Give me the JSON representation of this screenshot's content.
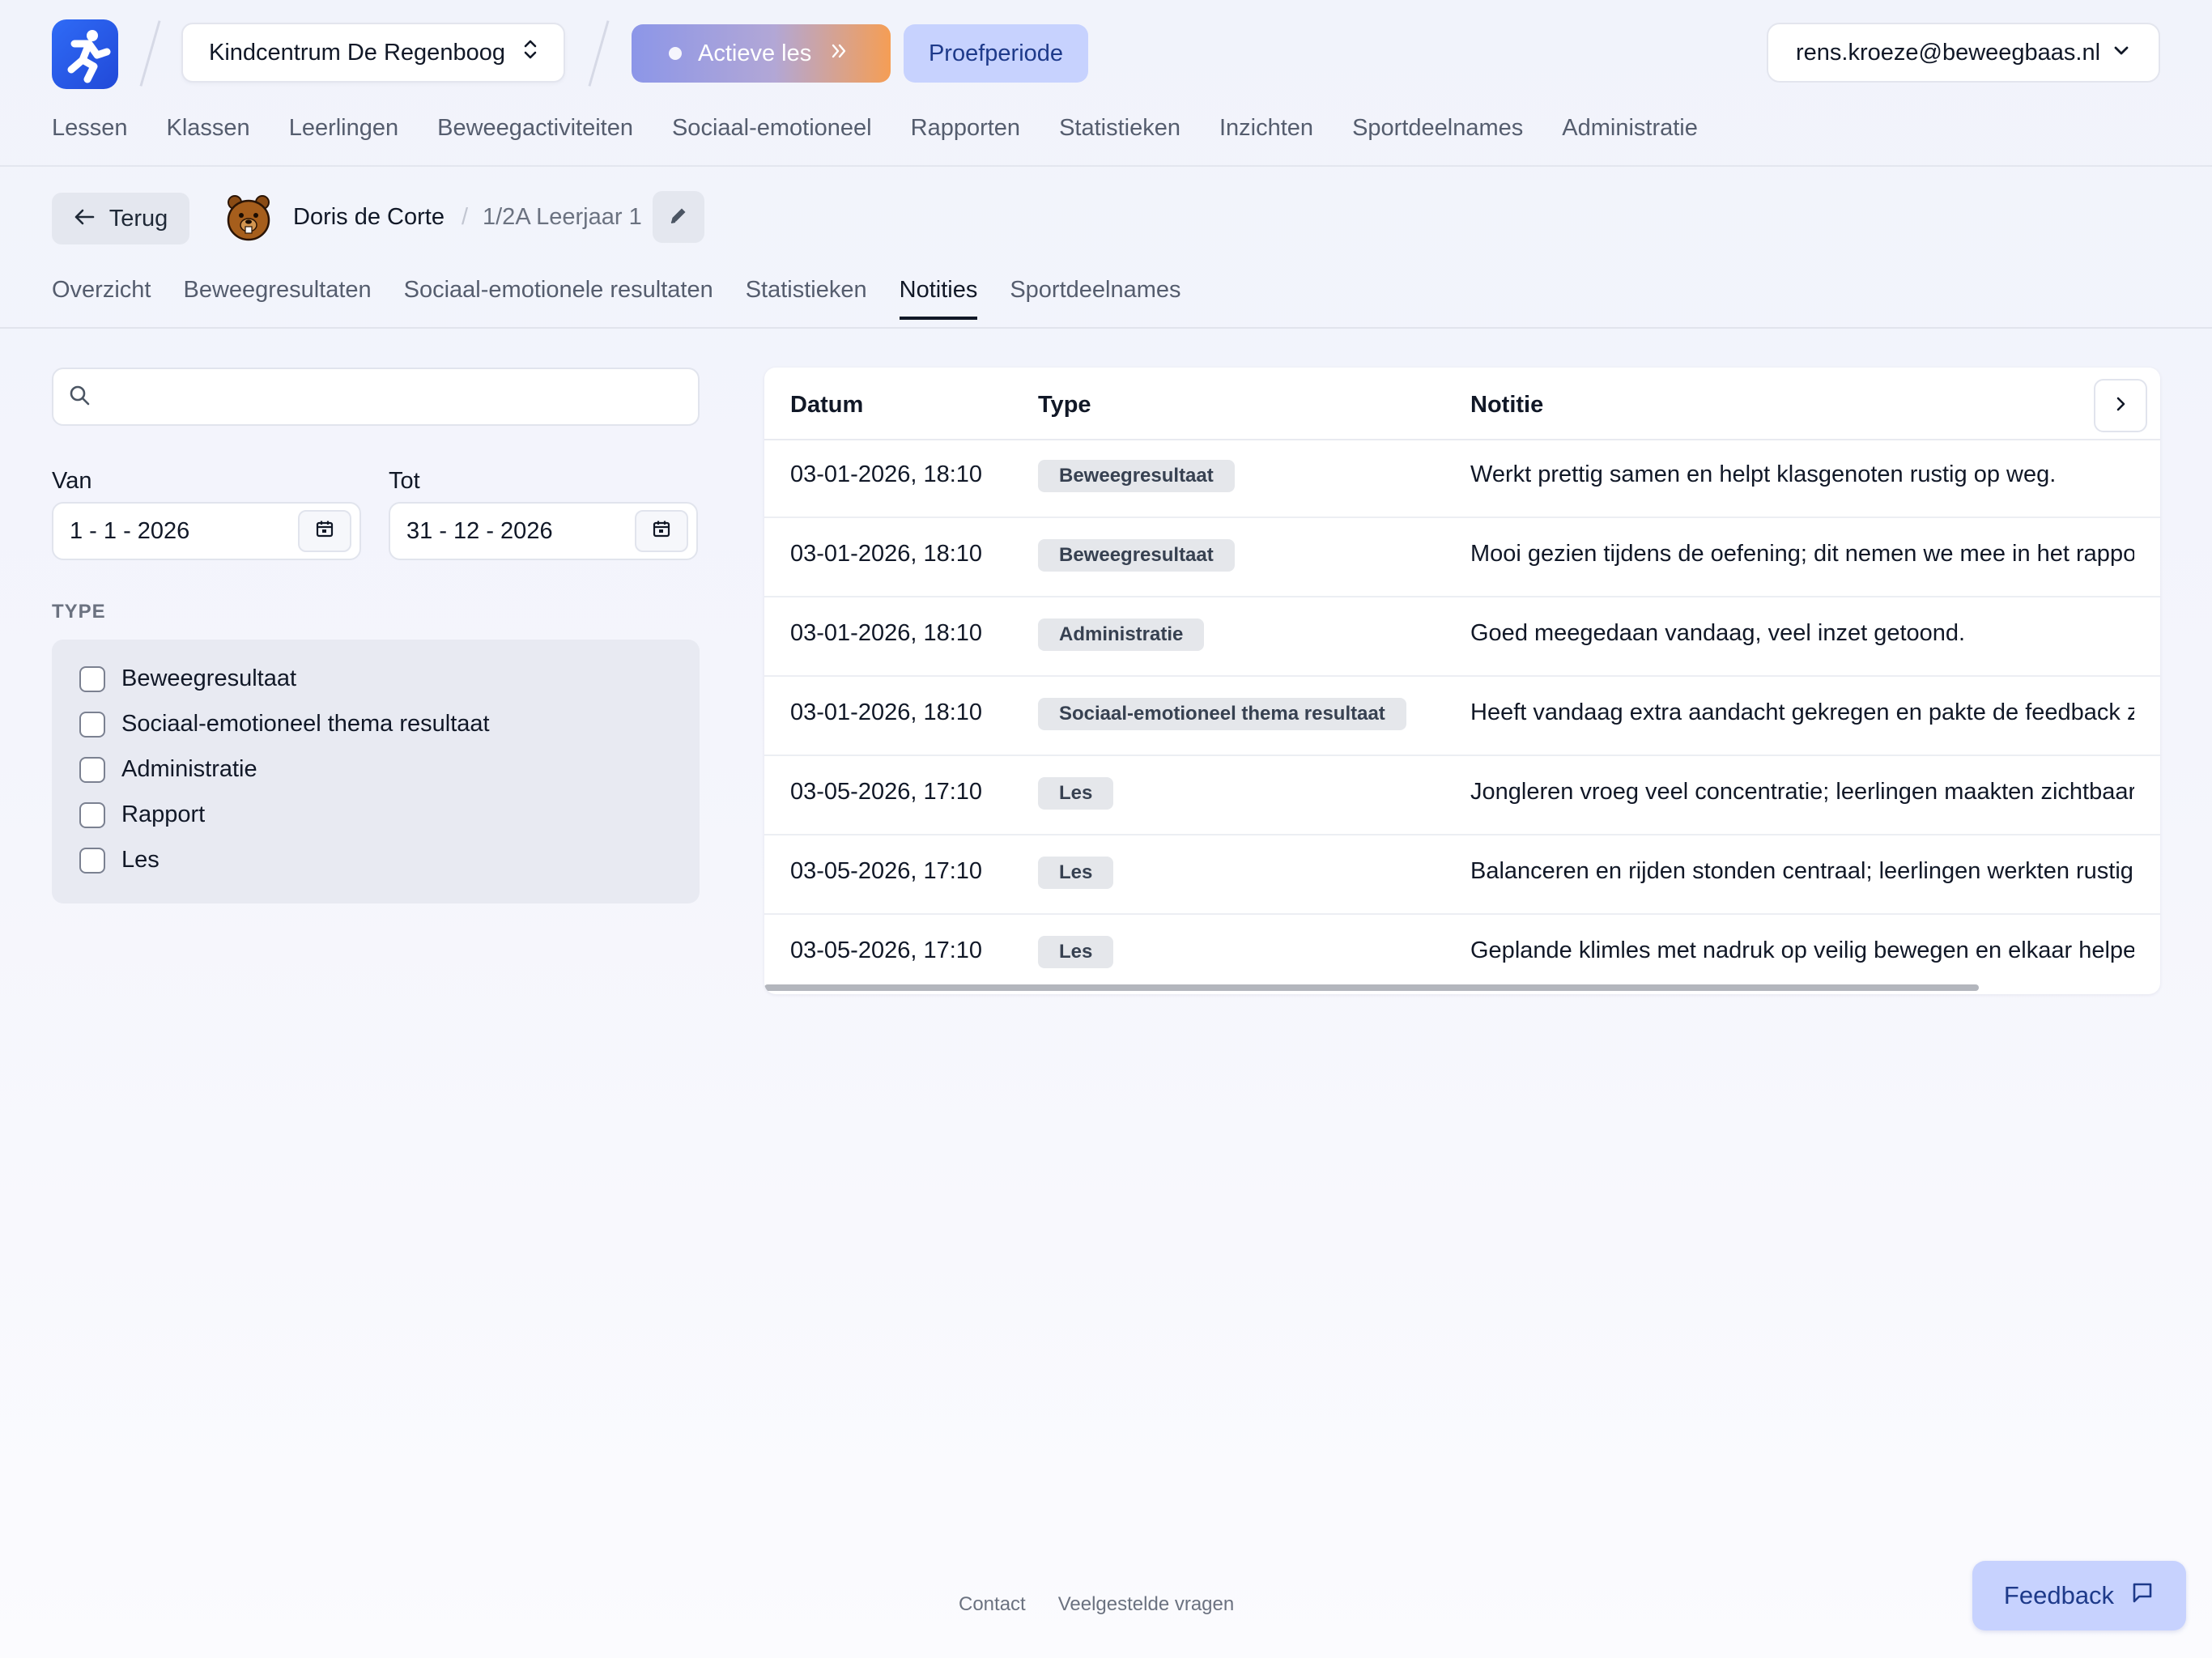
{
  "header": {
    "school": "Kindcentrum De Regenboog",
    "active_lesson": "Actieve les",
    "trial": "Proefperiode",
    "account": "rens.kroeze@beweegbaas.nl",
    "nav": [
      "Lessen",
      "Klassen",
      "Leerlingen",
      "Beweegactiviteiten",
      "Sociaal-emotioneel",
      "Rapporten",
      "Statistieken",
      "Inzichten",
      "Sportdeelnames",
      "Administratie"
    ]
  },
  "pupil": {
    "back_label": "Terug",
    "name": "Doris de Corte",
    "separator": "/",
    "class": "1/2A Leerjaar 1"
  },
  "tabs": [
    "Overzicht",
    "Beweegresultaten",
    "Sociaal-emotionele resultaten",
    "Statistieken",
    "Notities",
    "Sportdeelnames"
  ],
  "active_tab": "Notities",
  "filters": {
    "search_value": "",
    "from_label": "Van",
    "from_value": "1 - 1 - 2026",
    "to_label": "Tot",
    "to_value": "31 - 12 - 2026",
    "type_title": "TYPE",
    "types": [
      "Beweegresultaat",
      "Sociaal-emotioneel thema resultaat",
      "Administratie",
      "Rapport",
      "Les"
    ]
  },
  "table": {
    "columns": [
      "Datum",
      "Type",
      "Notitie"
    ],
    "rows": [
      {
        "date": "03-01-2026, 18:10",
        "type": "Beweegresultaat",
        "note": "Werkt prettig samen en helpt klasgenoten rustig op weg."
      },
      {
        "date": "03-01-2026, 18:10",
        "type": "Beweegresultaat",
        "note": "Mooi gezien tijdens de oefening; dit nemen we mee in het rappor"
      },
      {
        "date": "03-01-2026, 18:10",
        "type": "Administratie",
        "note": "Goed meegedaan vandaag, veel inzet getoond."
      },
      {
        "date": "03-01-2026, 18:10",
        "type": "Sociaal-emotioneel thema resultaat",
        "note": "Heeft vandaag extra aandacht gekregen en pakte de feedback z"
      },
      {
        "date": "03-05-2026, 17:10",
        "type": "Les",
        "note": "Jongleren vroeg veel concentratie; leerlingen maakten zichtbaar"
      },
      {
        "date": "03-05-2026, 17:10",
        "type": "Les",
        "note": "Balanceren en rijden stonden centraal; leerlingen werkten rustig"
      },
      {
        "date": "03-05-2026, 17:10",
        "type": "Les",
        "note": "Geplande klimles met nadruk op veilig bewegen en elkaar helper"
      }
    ]
  },
  "footer": {
    "links": [
      "Contact",
      "Veelgestelde vragen"
    ],
    "feedback": "Feedback"
  },
  "colors": {
    "brand": "#2f6bf6",
    "trial_bg": "#c7d2fe",
    "active_gradient_end": "#f59e55"
  },
  "icons": [
    "logo-icon",
    "updown-chevron-icon",
    "double-chevron-icon",
    "chevron-down-icon",
    "arrow-left-icon",
    "beaver-avatar-icon",
    "pencil-icon",
    "search-icon",
    "calendar-icon",
    "chevron-right-icon",
    "chat-icon"
  ]
}
